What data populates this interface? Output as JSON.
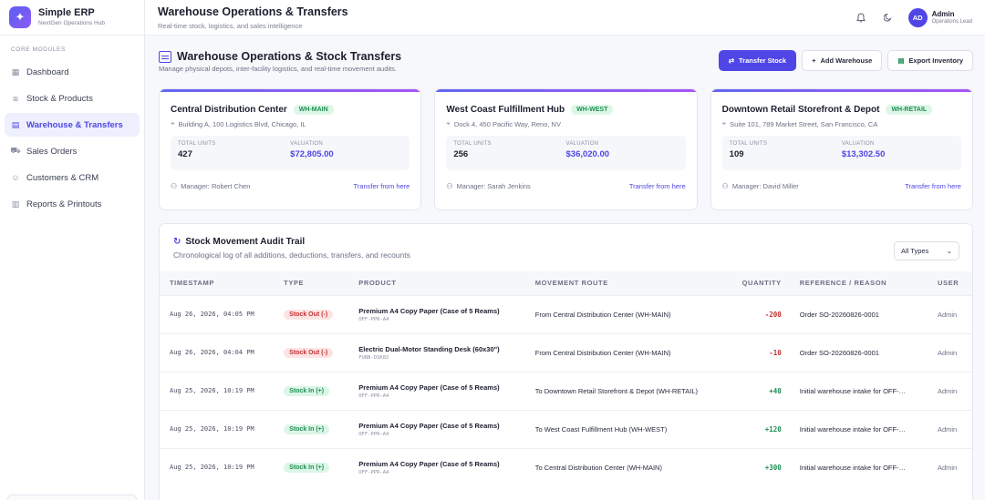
{
  "brand": {
    "name": "Simple ERP",
    "subtitle": "NextGen Operations Hub",
    "logo_icon": "sparkle-icon"
  },
  "sidebar": {
    "section_label": "CORE MODULES",
    "items": [
      {
        "label": "Dashboard",
        "icon": "grid-icon",
        "glyph": "▦"
      },
      {
        "label": "Stock & Products",
        "icon": "boxes-icon",
        "glyph": "⧈"
      },
      {
        "label": "Warehouse & Transfers",
        "icon": "warehouse-icon",
        "glyph": "▤",
        "active": true
      },
      {
        "label": "Sales Orders",
        "icon": "cart-icon",
        "glyph": "⛟"
      },
      {
        "label": "Customers & CRM",
        "icon": "users-icon",
        "glyph": "☺"
      },
      {
        "label": "Reports & Printouts",
        "icon": "chart-icon",
        "glyph": "▥"
      }
    ]
  },
  "topbar": {
    "title": "Warehouse Operations & Transfers",
    "subtitle": "Real-time stock, logistics, and sales intelligence",
    "user": {
      "initials": "AD",
      "name": "Admin",
      "role": "Operations Lead"
    }
  },
  "page": {
    "title": "Warehouse Operations & Stock Transfers",
    "subtitle": "Manage physical depots, inter-facility logistics, and real-time movement audits.",
    "actions": {
      "transfer": "Transfer Stock",
      "add": "Add Warehouse",
      "export": "Export Inventory"
    }
  },
  "warehouses": [
    {
      "name": "Central Distribution Center",
      "code": "WH-MAIN",
      "address": "Building A, 100 Logistics Blvd, Chicago, IL",
      "units_label": "TOTAL UNITS",
      "units": "427",
      "valuation_label": "VALUATION",
      "valuation": "$72,805.00",
      "manager": "Manager: Robert Chen",
      "link": "Transfer from here"
    },
    {
      "name": "West Coast Fulfillment Hub",
      "code": "WH-WEST",
      "address": "Dock 4, 450 Pacific Way, Reno, NV",
      "units_label": "TOTAL UNITS",
      "units": "256",
      "valuation_label": "VALUATION",
      "valuation": "$36,020.00",
      "manager": "Manager: Sarah Jenkins",
      "link": "Transfer from here"
    },
    {
      "name": "Downtown Retail Storefront & Depot",
      "code": "WH-RETAIL",
      "address": "Suite 101, 789 Market Street, San Francisco, CA",
      "units_label": "TOTAL UNITS",
      "units": "109",
      "valuation_label": "VALUATION",
      "valuation": "$13,302.50",
      "manager": "Manager: David Miller",
      "link": "Transfer from here"
    }
  ],
  "audit": {
    "title": "Stock Movement Audit Trail",
    "subtitle": "Chronological log of all additions, deductions, transfers, and recounts",
    "filter": "All Types",
    "columns": [
      "TIMESTAMP",
      "TYPE",
      "PRODUCT",
      "MOVEMENT ROUTE",
      "QUANTITY",
      "REFERENCE / REASON",
      "USER"
    ],
    "rows": [
      {
        "timestamp": "Aug 26, 2026, 04:05 PM",
        "type": "Stock Out (-)",
        "kind": "out",
        "product": "Premium A4 Copy Paper (Case of 5 Reams)",
        "sku": "OFF-PPR-A4",
        "route": "From Central Distribution Center (WH-MAIN)",
        "qty": "-200",
        "ref": "Order SO-20260826-0001",
        "user": "Admin"
      },
      {
        "timestamp": "Aug 26, 2026, 04:04 PM",
        "type": "Stock Out (-)",
        "kind": "out",
        "product": "Electric Dual-Motor Standing Desk (60x30\")",
        "sku": "FURN-DSK02",
        "route": "From Central Distribution Center (WH-MAIN)",
        "qty": "-10",
        "ref": "Order SO-20260826-0001",
        "user": "Admin"
      },
      {
        "timestamp": "Aug 25, 2026, 10:19 PM",
        "type": "Stock In (+)",
        "kind": "in",
        "product": "Premium A4 Copy Paper (Case of 5 Reams)",
        "sku": "OFF-PPR-A4",
        "route": "To Downtown Retail Storefront & Depot (WH-RETAIL)",
        "qty": "+40",
        "ref": "Initial warehouse intake for OFF-…",
        "user": "Admin"
      },
      {
        "timestamp": "Aug 25, 2026, 10:19 PM",
        "type": "Stock In (+)",
        "kind": "in",
        "product": "Premium A4 Copy Paper (Case of 5 Reams)",
        "sku": "OFF-PPR-A4",
        "route": "To West Coast Fulfillment Hub (WH-WEST)",
        "qty": "+120",
        "ref": "Initial warehouse intake for OFF-…",
        "user": "Admin"
      },
      {
        "timestamp": "Aug 25, 2026, 10:19 PM",
        "type": "Stock In (+)",
        "kind": "in",
        "product": "Premium A4 Copy Paper (Case of 5 Reams)",
        "sku": "OFF-PPR-A4",
        "route": "To Central Distribution Center (WH-MAIN)",
        "qty": "+300",
        "ref": "Initial warehouse intake for OFF-…",
        "user": "Admin"
      }
    ]
  },
  "colors": {
    "accent": "#4f46e5",
    "success": "#1f8f52",
    "danger": "#c53030"
  }
}
